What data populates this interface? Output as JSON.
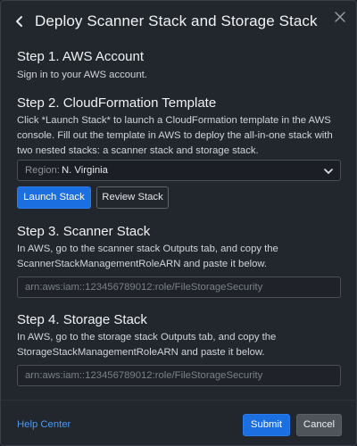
{
  "header": {
    "title": "Deploy Scanner Stack and Storage Stack"
  },
  "step1": {
    "heading": "Step 1. AWS Account",
    "text": "Sign in to your AWS account."
  },
  "step2": {
    "heading": "Step 2. CloudFormation Template",
    "text": "Click *Launch Stack* to launch a CloudFormation template in the AWS console. Fill out the template in AWS to deploy the all-in-one stack with two nested stacks: a scanner stack and storage stack.",
    "region_label": "Region:",
    "region_value": "N. Virginia",
    "launch_label": "Launch Stack",
    "review_label": "Review Stack"
  },
  "step3": {
    "heading": "Step 3. Scanner Stack",
    "text": "In AWS, go to the scanner stack Outputs tab, and copy the ScannerStackManagementRoleARN and paste it below.",
    "placeholder": "arn:aws:iam::123456789012:role/FileStorageSecurity"
  },
  "step4": {
    "heading": "Step 4. Storage Stack",
    "text": "In AWS, go to the storage stack Outputs tab, and copy the StorageStackManagementRoleARN and paste it below.",
    "placeholder": "arn:aws:iam::123456789012:role/FileStorageSecurity"
  },
  "footer": {
    "help_label": "Help Center",
    "submit_label": "Submit",
    "cancel_label": "Cancel"
  },
  "colors": {
    "background": "#22262d",
    "primary": "#1c6fe0",
    "link": "#4d9af3",
    "cancel_button": "#4f545b"
  },
  "icons": {
    "back": "chevron-left-icon",
    "close": "close-icon",
    "dropdown": "chevron-down-icon"
  }
}
